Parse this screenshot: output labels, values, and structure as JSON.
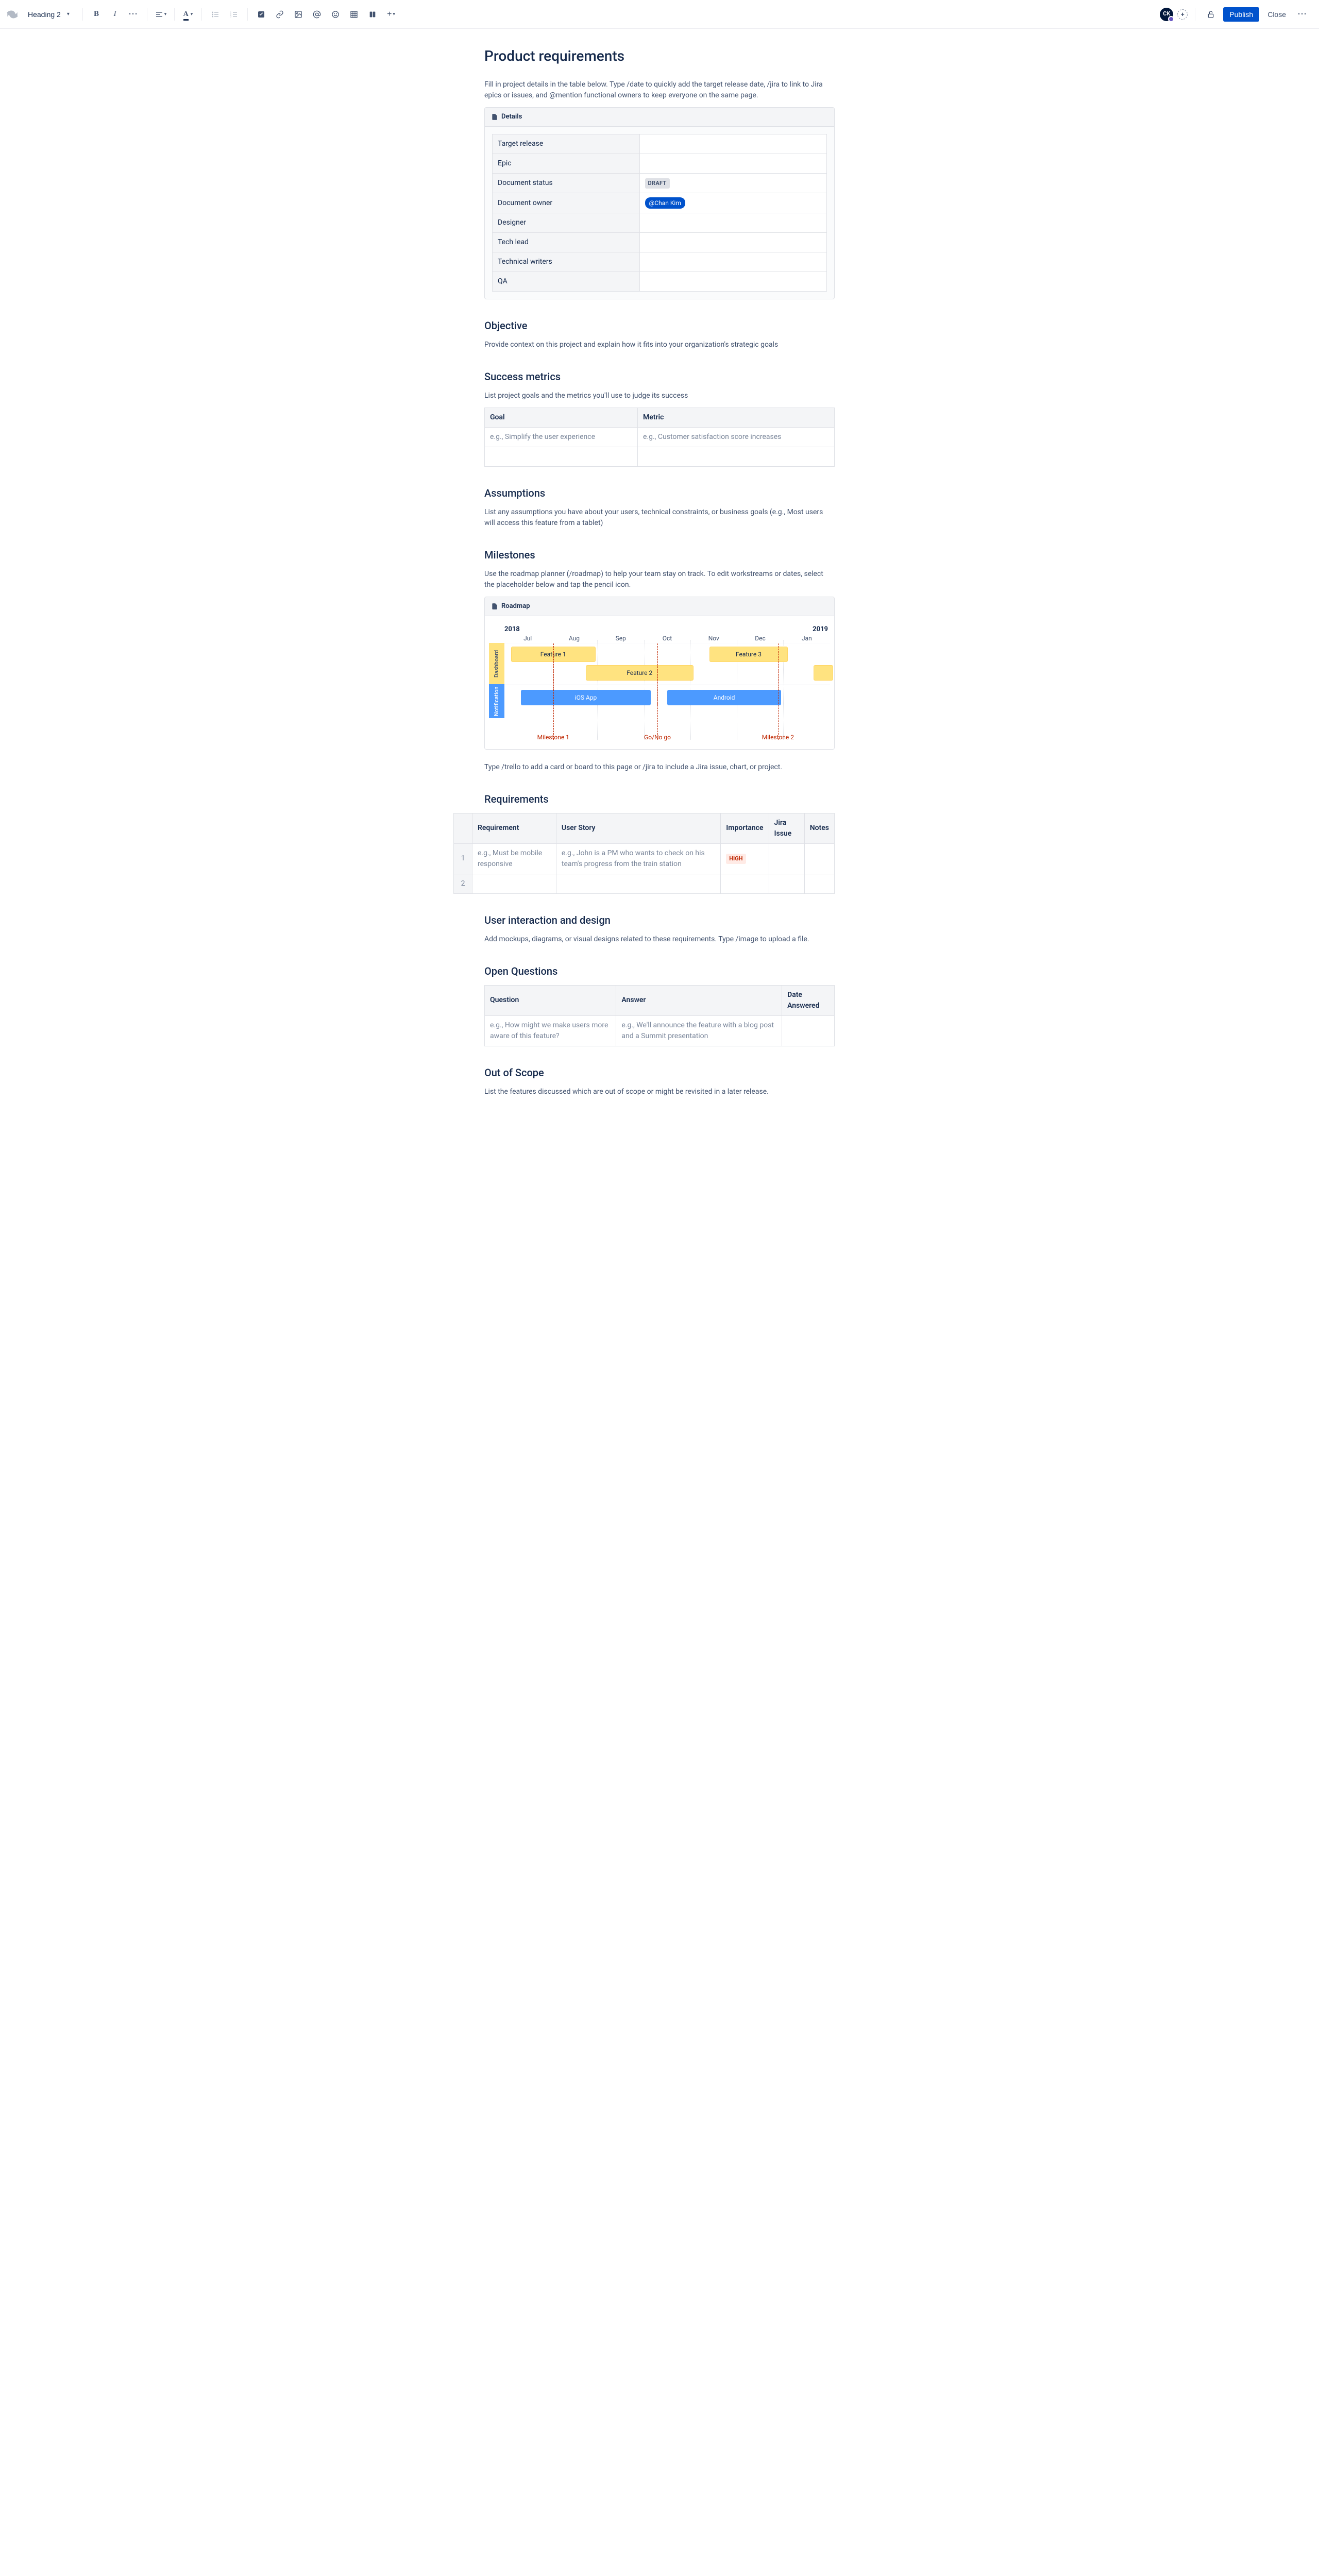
{
  "toolbar": {
    "style_selector": "Heading 2",
    "publish": "Publish",
    "close": "Close",
    "user_initials": "CK"
  },
  "page": {
    "title": "Product requirements",
    "intro": "Fill in project details in the table below. Type /date to quickly add the target release date, /jira to link to Jira epics or issues, and @mention functional owners to keep everyone on the same page."
  },
  "details_panel": {
    "title": "Details",
    "rows": [
      {
        "label": "Target release",
        "value": ""
      },
      {
        "label": "Epic",
        "value": ""
      },
      {
        "label": "Document status",
        "status": "DRAFT"
      },
      {
        "label": "Document owner",
        "mention": "@Chan Kim"
      },
      {
        "label": "Designer",
        "value": ""
      },
      {
        "label": "Tech lead",
        "value": ""
      },
      {
        "label": "Technical writers",
        "value": ""
      },
      {
        "label": "QA",
        "value": ""
      }
    ]
  },
  "objective": {
    "heading": "Objective",
    "text": "Provide context on this project and explain how it fits into your organization's strategic goals"
  },
  "success": {
    "heading": "Success metrics",
    "text": "List project goals and the metrics you'll use to judge its success",
    "columns": [
      "Goal",
      "Metric"
    ],
    "rows": [
      [
        "e.g., Simplify the user experience",
        "e.g., Customer satisfaction score increases"
      ],
      [
        "",
        ""
      ]
    ]
  },
  "assumptions": {
    "heading": "Assumptions",
    "text": "List any assumptions you have about your users, technical constraints, or business goals (e.g., Most users will access this feature from a tablet)"
  },
  "milestones": {
    "heading": "Milestones",
    "text": "Use the roadmap planner (/roadmap) to help your team stay on track. To edit workstreams or dates, select the placeholder below and tap the pencil icon.",
    "panel_title": "Roadmap",
    "year_start": "2018",
    "year_end": "2019",
    "months": [
      "Jul",
      "Aug",
      "Sep",
      "Oct",
      "Nov",
      "Dec",
      "Jan"
    ],
    "lanes": [
      {
        "name": "Dashboard",
        "color": "yellow"
      },
      {
        "name": "Notification",
        "color": "blue"
      }
    ],
    "bars": [
      {
        "lane": 0,
        "row": 0,
        "label": "Feature 1",
        "start_pct": 2,
        "width_pct": 26,
        "style": "y"
      },
      {
        "lane": 0,
        "row": 0,
        "label": "Feature 3",
        "start_pct": 63,
        "width_pct": 24,
        "style": "y"
      },
      {
        "lane": 0,
        "row": 1,
        "label": "Feature 2",
        "start_pct": 25,
        "width_pct": 33,
        "style": "y"
      },
      {
        "lane": 0,
        "row": 1,
        "label": "",
        "start_pct": 95,
        "width_pct": 6,
        "style": "y"
      },
      {
        "lane": 1,
        "row": 0,
        "label": "iOS App",
        "start_pct": 5,
        "width_pct": 40,
        "style": "b"
      },
      {
        "lane": 1,
        "row": 0,
        "label": "Android",
        "start_pct": 50,
        "width_pct": 35,
        "style": "b"
      }
    ],
    "milestones_list": [
      {
        "label": "Milestone 1",
        "pct": 15
      },
      {
        "label": "Go/No go",
        "pct": 47
      },
      {
        "label": "Milestone 2",
        "pct": 84
      }
    ],
    "footnote": "Type /trello to add a card or board to this page or /jira to include a Jira issue, chart, or project."
  },
  "requirements": {
    "heading": "Requirements",
    "columns": [
      "",
      "Requirement",
      "User Story",
      "Importance",
      "Jira Issue",
      "Notes"
    ],
    "rows": [
      {
        "n": "1",
        "req": "e.g., Must be mobile responsive",
        "story": "e.g., John is a PM who wants to check on his team's progress from the train station",
        "importance": "HIGH",
        "jira": "",
        "notes": ""
      },
      {
        "n": "2",
        "req": "",
        "story": "",
        "importance": "",
        "jira": "",
        "notes": ""
      }
    ]
  },
  "uidesign": {
    "heading": "User interaction and design",
    "text": "Add mockups, diagrams, or visual designs related to these requirements. Type /image to upload a file."
  },
  "openq": {
    "heading": "Open Questions",
    "columns": [
      "Question",
      "Answer",
      "Date Answered"
    ],
    "rows": [
      [
        "e.g., How might we make users more aware of this feature?",
        "e.g., We'll announce the feature with a blog post and a Summit presentation",
        ""
      ]
    ]
  },
  "outscope": {
    "heading": "Out of Scope",
    "text": "List the features discussed which are out of scope or might be revisited in a later release."
  }
}
